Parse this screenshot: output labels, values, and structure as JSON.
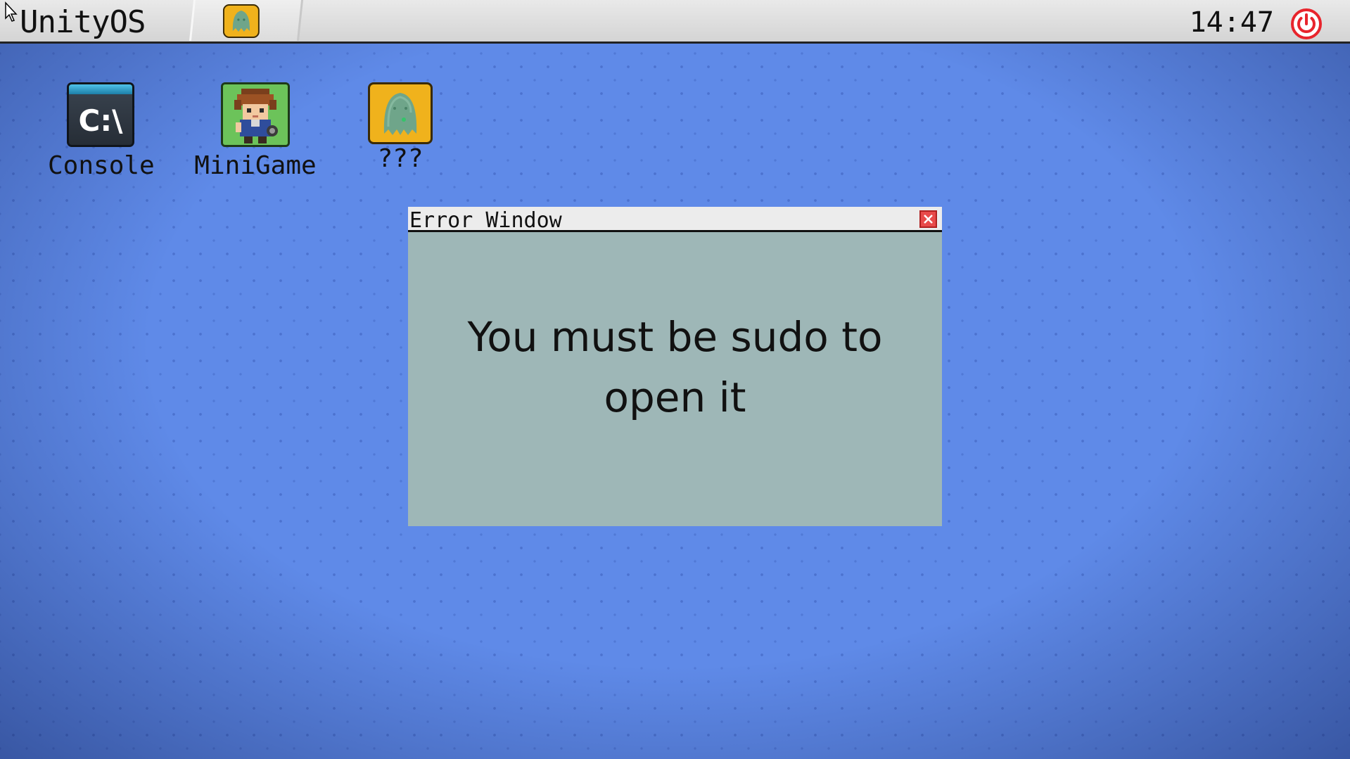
{
  "taskbar": {
    "os_name": "UnityOS",
    "clock": "14:47",
    "power_color": "#e8242c",
    "running_app_icon": "ghost-icon"
  },
  "desktop": {
    "icons": [
      {
        "label": "Console",
        "icon": "console-icon",
        "glyph": "C:\\"
      },
      {
        "label": "MiniGame",
        "icon": "pixel-character-icon"
      },
      {
        "label": "???",
        "icon": "ghost-icon"
      }
    ]
  },
  "error_window": {
    "title": "Error Window",
    "message": "You must be sudo to open it"
  },
  "colors": {
    "desktop_bg": "#5f8ae8",
    "window_body": "#9eb7b7",
    "close_button": "#e84a4a",
    "ghost_icon_bg": "#f0b21c"
  }
}
